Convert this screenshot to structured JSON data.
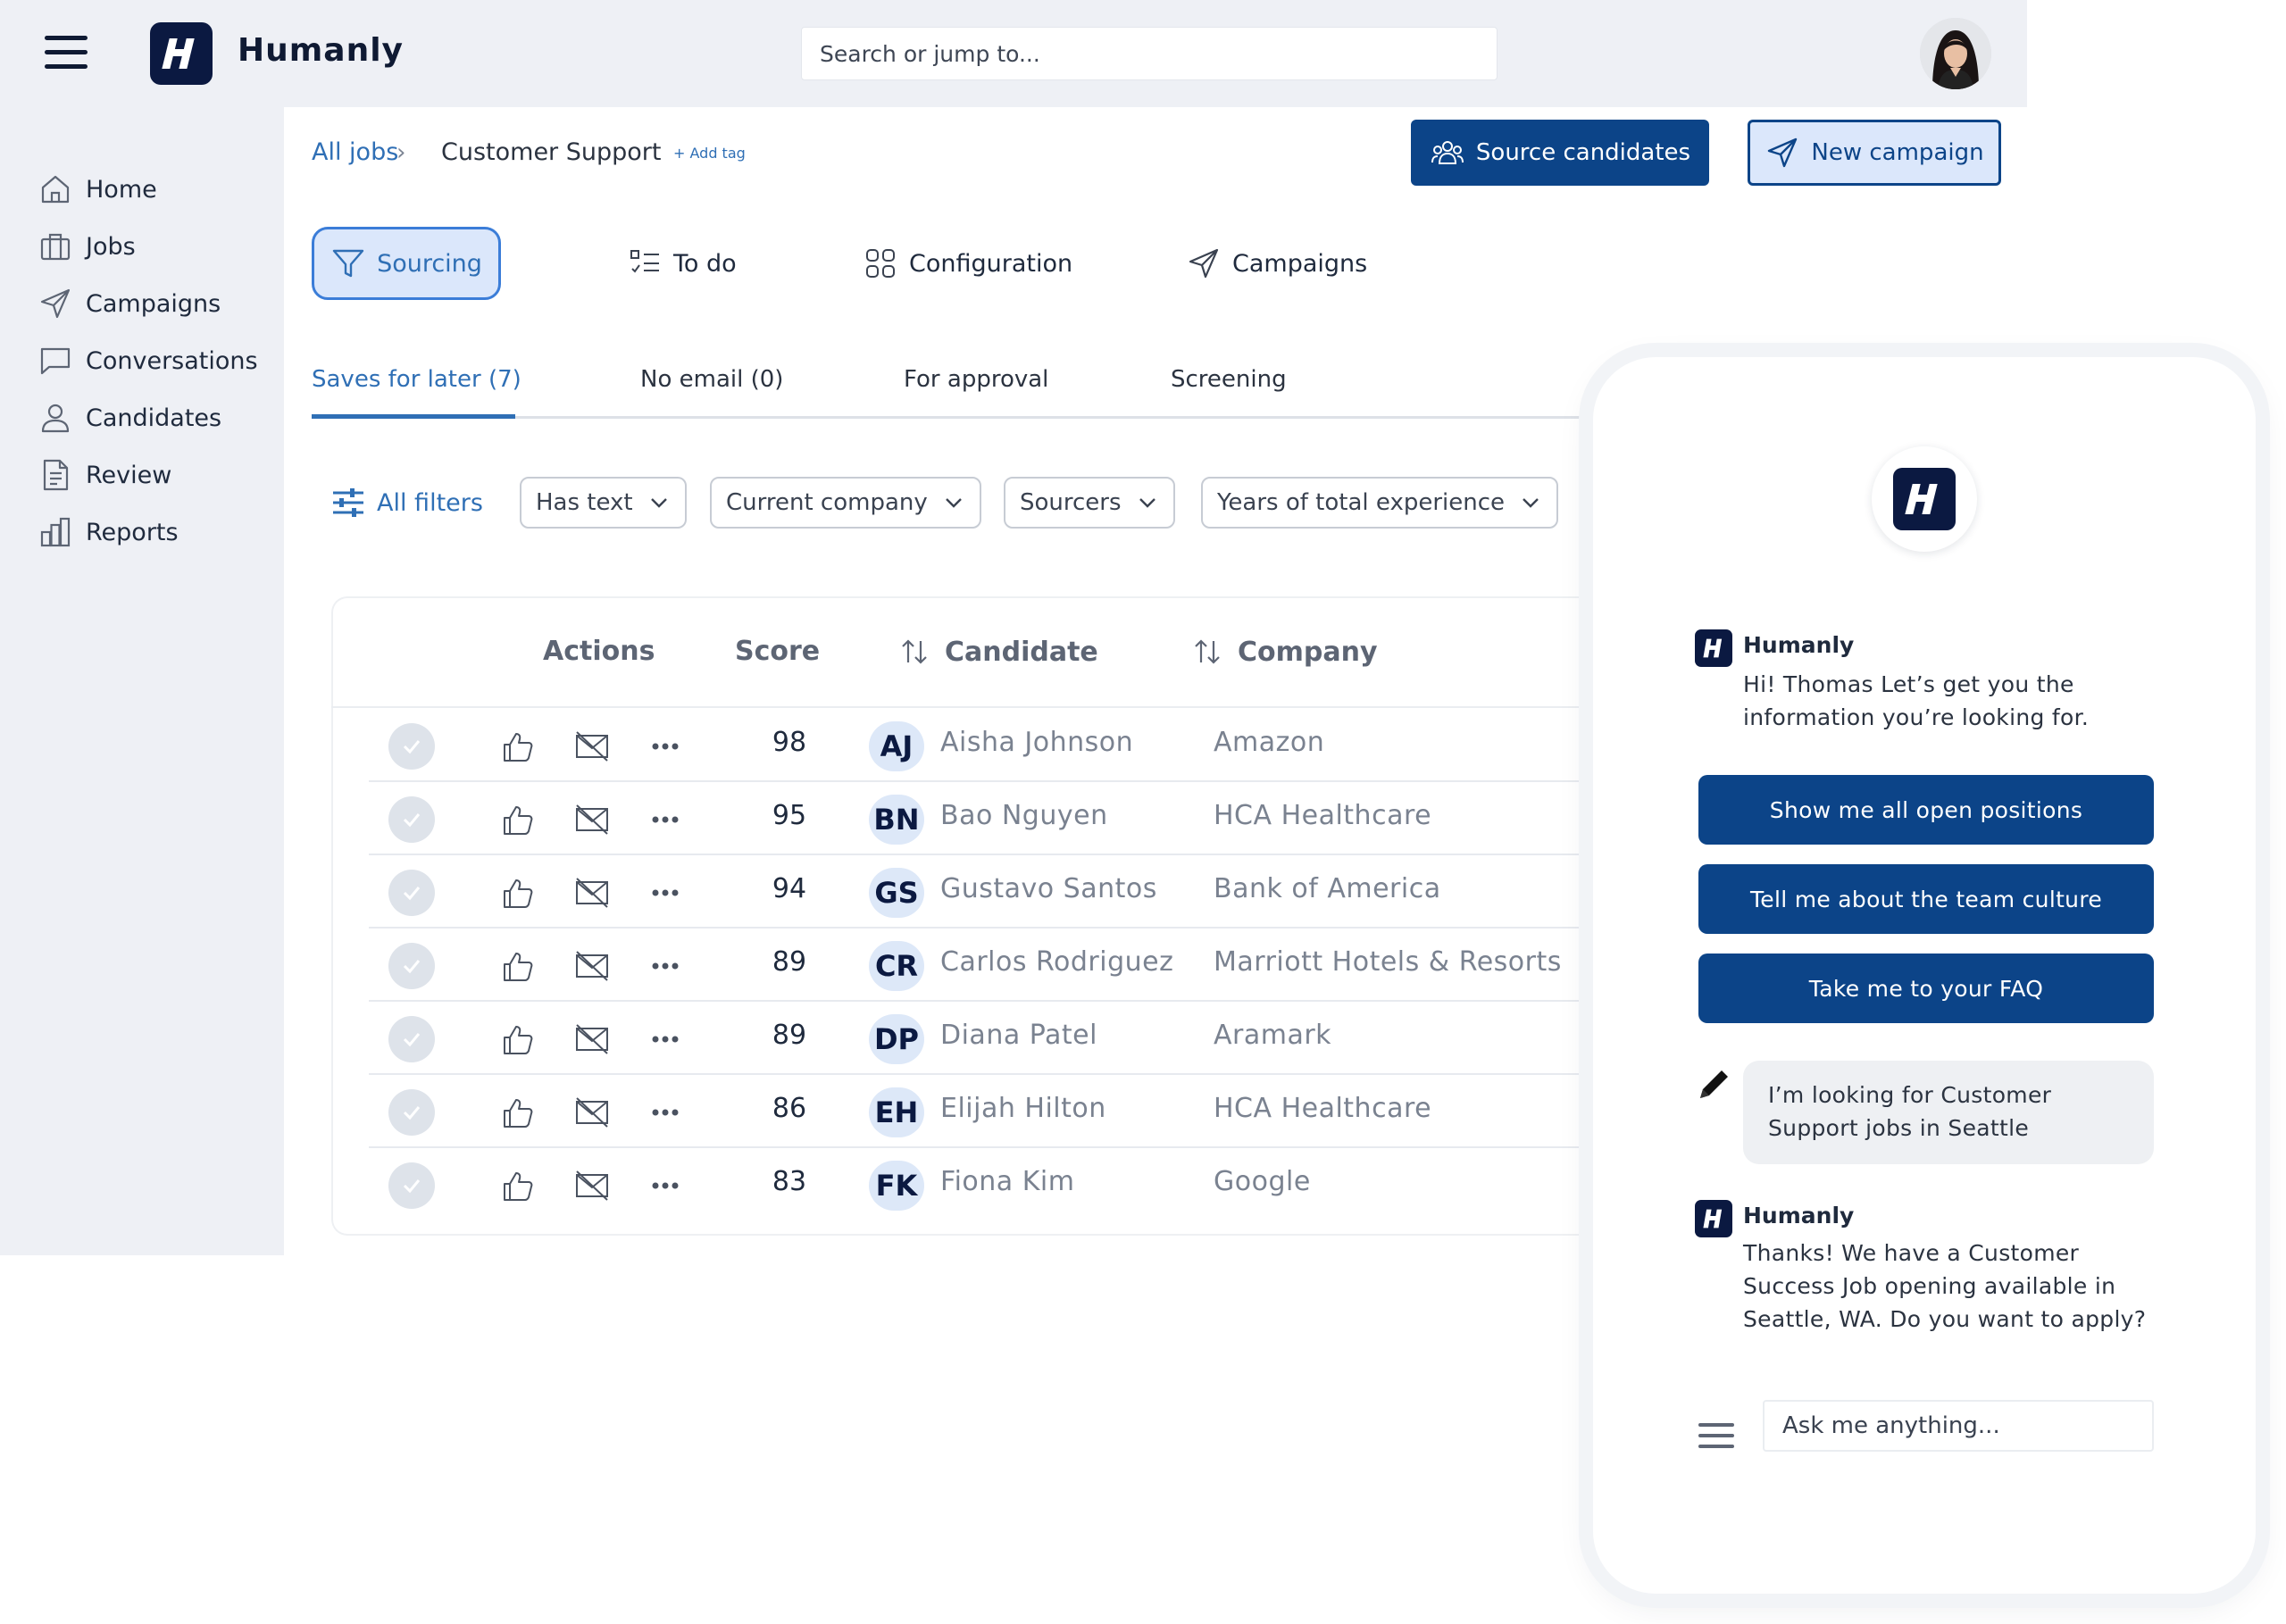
{
  "app": {
    "title": "Humanly",
    "logo_letter": "H"
  },
  "search": {
    "placeholder": "Search or jump to..."
  },
  "sidebar": {
    "items": [
      {
        "label": "Home",
        "icon": "home-icon"
      },
      {
        "label": "Jobs",
        "icon": "briefcase-icon"
      },
      {
        "label": "Campaigns",
        "icon": "send-icon"
      },
      {
        "label": "Conversations",
        "icon": "chat-bubble-icon"
      },
      {
        "label": "Candidates",
        "icon": "person-icon"
      },
      {
        "label": "Review",
        "icon": "document-icon"
      },
      {
        "label": "Reports",
        "icon": "bar-chart-icon"
      }
    ]
  },
  "breadcrumb": {
    "all_jobs": "All jobs",
    "current": "Customer Support",
    "add_tag": "+ Add tag"
  },
  "actions": {
    "source_candidates": "Source candidates",
    "new_campaign": "New campaign"
  },
  "main_tabs": [
    {
      "label": "Sourcing",
      "active": true
    },
    {
      "label": "To do"
    },
    {
      "label": "Configuration"
    },
    {
      "label": "Campaigns"
    }
  ],
  "sub_tabs": [
    {
      "label": "Saves for later (7)",
      "active": true
    },
    {
      "label": "No email (0)"
    },
    {
      "label": "For approval"
    },
    {
      "label": "Screening"
    }
  ],
  "filters": {
    "all_filters": "All filters",
    "dropdowns": [
      "Has text",
      "Current company",
      "Sourcers",
      "Years of total experience"
    ]
  },
  "table": {
    "headers": {
      "actions": "Actions",
      "score": "Score",
      "candidate": "Candidate",
      "company": "Company"
    },
    "rows": [
      {
        "score": "98",
        "initials": "AJ",
        "name": "Aisha Johnson",
        "company": "Amazon"
      },
      {
        "score": "95",
        "initials": "BN",
        "name": "Bao Nguyen",
        "company": "HCA Healthcare"
      },
      {
        "score": "94",
        "initials": "GS",
        "name": "Gustavo Santos",
        "company": "Bank of America"
      },
      {
        "score": "89",
        "initials": "CR",
        "name": "Carlos Rodriguez",
        "company": "Marriott Hotels & Resorts"
      },
      {
        "score": "89",
        "initials": "DP",
        "name": "Diana Patel",
        "company": "Aramark"
      },
      {
        "score": "86",
        "initials": "EH",
        "name": "Elijah Hilton",
        "company": "HCA Healthcare"
      },
      {
        "score": "83",
        "initials": "FK",
        "name": "Fiona Kim",
        "company": "Google"
      }
    ]
  },
  "chat": {
    "bot_name": "Humanly",
    "greeting": "Hi! Thomas Let’s get you the information you’re looking for.",
    "quick_replies": [
      "Show me all open positions",
      "Tell me about the team culture",
      "Take me to your FAQ"
    ],
    "user_message": "I’m looking for Customer Support jobs in Seattle",
    "bot_reply": "Thanks! We have a Customer Success Job opening available in Seattle, WA. Do you want to apply?",
    "input_placeholder": "Ask me anything..."
  },
  "colors": {
    "brand_navy": "#0b1941",
    "primary_blue": "#0c4488",
    "link_blue": "#2f6fb5",
    "sidebar_bg": "#eef0f5"
  }
}
